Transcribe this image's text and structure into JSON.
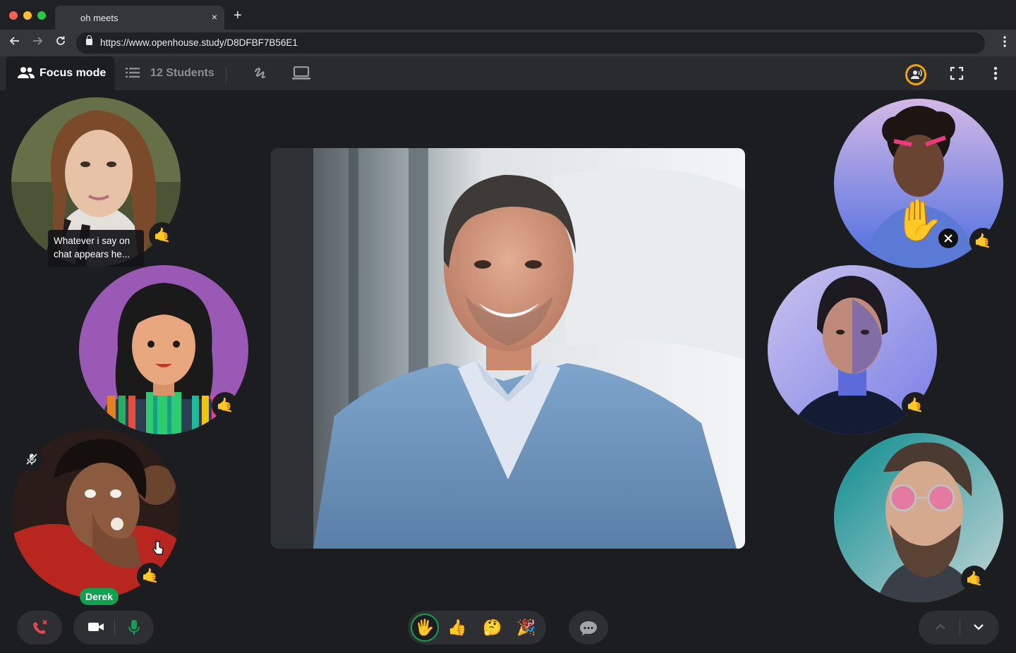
{
  "browser": {
    "tab_title": "oh meets",
    "tab_close": "×",
    "new_tab": "+",
    "url": "https://www.openhouse.study/D8DFBF7B56E1"
  },
  "app_bar": {
    "mode_label": "Focus mode",
    "students_label": "12 Students"
  },
  "participants": {
    "chat_message": "Whatever i say on chat appears he...",
    "name_tag": "Derek",
    "reaction_emoji": "🤙",
    "raised_hand_emoji": "✋"
  },
  "reactions": [
    "🖐️",
    "👍",
    "🤔",
    "🎉"
  ],
  "colors": {
    "background": "#1c1d20",
    "accent_green": "#12a150",
    "end_call_red": "#e5484d",
    "timer_ring": "#f0a500"
  }
}
